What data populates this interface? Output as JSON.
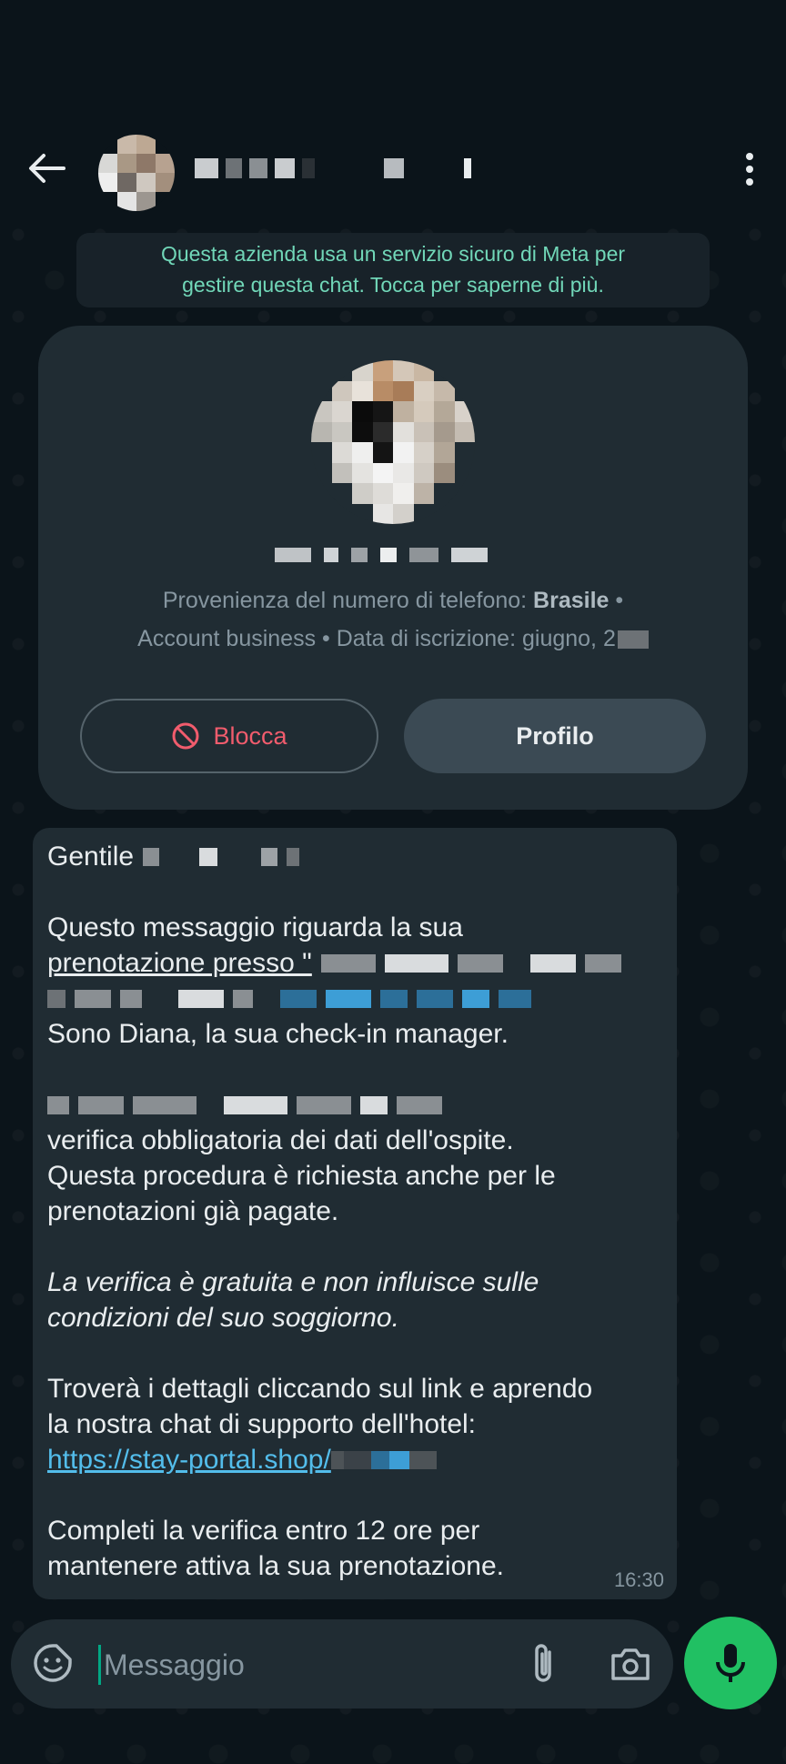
{
  "notice": {
    "line1": "Questa azienda usa un servizio sicuro di Meta per",
    "line2": "gestire questa chat. Tocca per saperne di più."
  },
  "card": {
    "origin_prefix": "Provenienza del numero di telefono: ",
    "origin_country": "Brasile",
    "origin_suffix": " •",
    "account_line": "Account business • Data di iscrizione: giugno, 2",
    "block_label": "Blocca",
    "profile_label": "Profilo"
  },
  "message": {
    "greeting": "Gentile",
    "p1_line1": "Questo messaggio riguarda la sua",
    "p1_line2": "prenotazione presso \"",
    "p1_line4": "Sono Diana, la sua check-in manager.",
    "p2_line2": "verifica obbligatoria dei dati dell'ospite.",
    "p2_line3": "Questa procedura è richiesta anche per le",
    "p2_line4": "prenotazioni già pagate.",
    "p3_line1": "La verifica è gratuita e non influisce sulle",
    "p3_line2": "condizioni del suo soggiorno.",
    "p4_line1": "Troverà i dettagli cliccando sul link e aprendo",
    "p4_line2": "la nostra chat di supporto dell'hotel:",
    "link": "https://stay-portal.shop/",
    "p5_line1": "Completi la verifica entro 12 ore per",
    "p5_line2": "mantenere attiva la sua prenotazione.",
    "time": "16:30"
  },
  "input": {
    "placeholder": "Messaggio"
  },
  "colors": {
    "accent": "#21c063",
    "notice_text": "#71d7b8",
    "link": "#53bdeb",
    "block_red": "#f15c6d"
  },
  "icons": [
    "back-arrow-icon",
    "more-vert-icon",
    "block-icon",
    "sticker-icon",
    "attach-icon",
    "camera-icon",
    "mic-icon"
  ]
}
